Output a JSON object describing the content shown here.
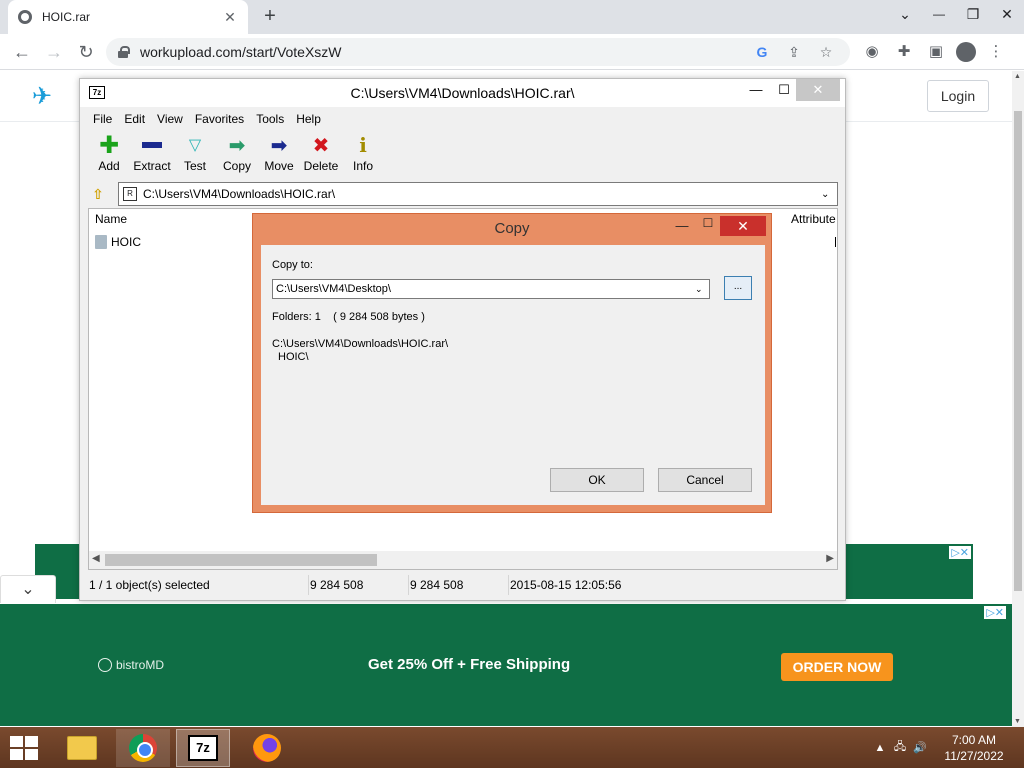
{
  "browser": {
    "tab_title": "HOIC.rar",
    "tab_close": "✕",
    "new_tab": "+",
    "url": "workupload.com/start/VoteXszW",
    "window_controls": {
      "chevron": "⌄",
      "minimize": "—",
      "restore": "❐",
      "close": "✕"
    },
    "nav": {
      "back": "←",
      "forward": "→",
      "reload": "↻"
    },
    "omnibox_icons": {
      "google": "G",
      "share": "⇪",
      "bookmark": "☆"
    },
    "extension_icons": {
      "ext": "◉",
      "puzzle": "✚",
      "sidepanel": "▣",
      "menu": "⋮"
    }
  },
  "website": {
    "logo_glyph": "✈",
    "login_label": "Login",
    "ad_close": "▷✕",
    "collapse_chevron": "⌄",
    "ad": {
      "brand": "bistroMD",
      "headline": "Get 25% Off + Free Shipping",
      "cta": "ORDER NOW",
      "background": "#0f6e45",
      "cta_color": "#f7941d"
    },
    "scroll_up": "▲",
    "scroll_down": "▼"
  },
  "sevenzip": {
    "app_icon": "7z",
    "title": "C:\\Users\\VM4\\Downloads\\HOIC.rar\\",
    "controls": {
      "minimize": "—",
      "maximize": "☐",
      "close": "✕"
    },
    "menu": [
      "File",
      "Edit",
      "View",
      "Favorites",
      "Tools",
      "Help"
    ],
    "toolbar": [
      {
        "id": "add",
        "label": "Add",
        "glyph": "✚"
      },
      {
        "id": "extract",
        "label": "Extract",
        "glyph": ""
      },
      {
        "id": "test",
        "label": "Test",
        "glyph": "▽"
      },
      {
        "id": "copy",
        "label": "Copy",
        "glyph": "➡"
      },
      {
        "id": "move",
        "label": "Move",
        "glyph": "➡"
      },
      {
        "id": "delete",
        "label": "Delete",
        "glyph": "✖"
      },
      {
        "id": "info",
        "label": "Info",
        "glyph": "i"
      }
    ],
    "up_glyph": "⇧",
    "address": "C:\\Users\\VM4\\Downloads\\HOIC.rar\\",
    "address_icon": "R",
    "dropdown": "⌄",
    "columns": {
      "name": "Name",
      "attributes": "Attribute"
    },
    "items": [
      {
        "name": "HOIC"
      }
    ],
    "scroll_left": "◀",
    "scroll_right": "▶",
    "status": {
      "selected": "1 / 1 object(s) selected",
      "size": "9 284 508",
      "packed": "9 284 508",
      "modified": "2015-08-15 12:05:56"
    }
  },
  "copy_dialog": {
    "title": "Copy",
    "controls": {
      "minimize": "—",
      "maximize": "☐",
      "close": "✕"
    },
    "copy_to_label": "Copy to:",
    "destination": "C:\\Users\\VM4\\Desktop\\",
    "dropdown": "⌄",
    "browse_label": "...",
    "info": "Folders: 1    ( 9 284 508 bytes )",
    "source_path": "C:\\Users\\VM4\\Downloads\\HOIC.rar\\",
    "source_item": "HOIC\\",
    "ok_label": "OK",
    "cancel_label": "Cancel"
  },
  "taskbar": {
    "seven_zip_label": "7z",
    "tray_icons": {
      "expand": "▲",
      "network": "🖧",
      "volume": "🔊"
    },
    "time": "7:00 AM",
    "date": "11/27/2022"
  }
}
